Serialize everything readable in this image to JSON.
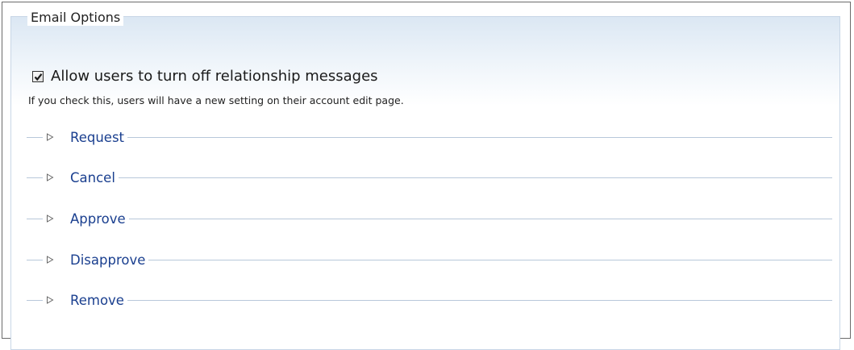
{
  "fieldset": {
    "legend": "Email Options"
  },
  "setting": {
    "checkbox_label": "Allow users to turn off relationship messages",
    "checked": true,
    "description": "If you check this, users will have a new setting on their account edit page."
  },
  "sections": [
    {
      "label": "Request"
    },
    {
      "label": "Cancel"
    },
    {
      "label": "Approve"
    },
    {
      "label": "Disapprove"
    },
    {
      "label": "Remove"
    }
  ],
  "colors": {
    "link": "#1a3f8f",
    "rule": "#b8c8da"
  }
}
